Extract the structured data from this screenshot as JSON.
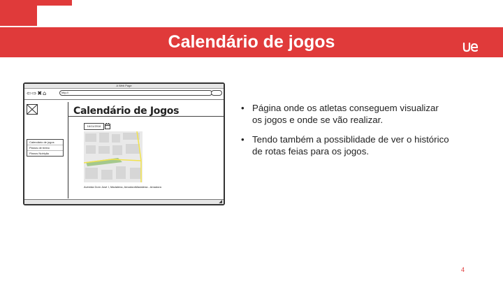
{
  "slide": {
    "title": "Calendário de jogos",
    "page_number": "4",
    "brand_color": "#e03a3a"
  },
  "logo": {
    "icon": "ue-logo"
  },
  "mockup": {
    "window_title": "A Web Page",
    "url": "http://",
    "nav_icons": [
      "back-arrow-icon",
      "forward-arrow-icon",
      "close-icon",
      "home-icon"
    ],
    "page_heading": "Calendário de Jogos",
    "date_value": "16/11/2016",
    "menu_items": [
      "Calendário de jogos",
      "Planos de treino",
      "Planos Nutrição"
    ],
    "address": "Avenida Dom José I, Madalena, AmadoraMadalena - Amadora"
  },
  "bullets": [
    "Página onde os atletas conseguem visualizar os jogos e onde se vão realizar.",
    "Tendo também  a possiblidade de ver o histórico de rotas feias para os jogos."
  ]
}
